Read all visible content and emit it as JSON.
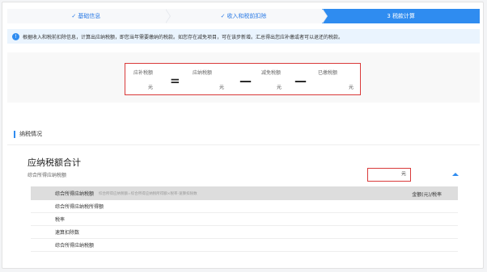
{
  "steps": [
    {
      "label": "基础信息",
      "done": true
    },
    {
      "label": "收入和税前扣除",
      "done": true
    },
    {
      "label": "3 税款计算",
      "done": false
    }
  ],
  "notice": {
    "text": "根据收入和税前扣除信息，计算出应纳税额，即您当年需要缴纳的税款。如您存在减免项目，可在该步新增。汇总得出您应补缴或者可以退还的税款。"
  },
  "formula": {
    "items": [
      {
        "label": "应补税额",
        "unit": "元"
      },
      {
        "label": "应纳税额",
        "unit": "元"
      },
      {
        "label": "减免税额",
        "unit": "元"
      },
      {
        "label": "已缴税额",
        "unit": "元"
      }
    ],
    "operators": [
      "=",
      "—",
      "—"
    ]
  },
  "section": {
    "title": "纳税情况",
    "big_title": "应纳税额合计",
    "sub_title": "综合所得应纳税额",
    "amount_unit": "元"
  },
  "table": {
    "header_label": "综合所得应纳税额",
    "header_hint": "综合所得应纳税额=综合所得应纳税所得额×税率-速算扣除数",
    "header_rate": "金额(元)/税率",
    "rows": [
      "综合所得应纳税所得额",
      "税率",
      "速算扣除数",
      "综合所得应纳税额"
    ]
  },
  "colors": {
    "accent": "#2f8cf0",
    "highlight": "#d93a3a"
  }
}
